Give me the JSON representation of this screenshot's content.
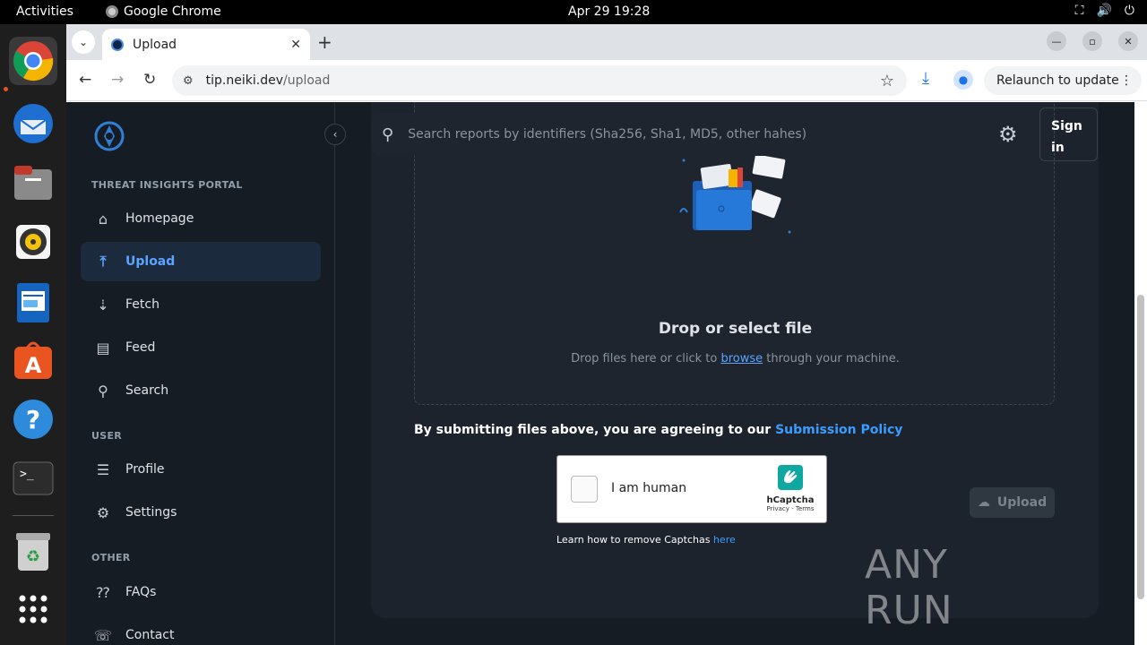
{
  "os": {
    "activities": "Activities",
    "app_name": "Google Chrome",
    "clock": "Apr 29  19:28"
  },
  "browser": {
    "tab_title": "Upload",
    "url_domain": "tip.neiki.dev",
    "url_path": "/upload",
    "relaunch_label": "Relaunch to update"
  },
  "sidebar": {
    "section_portal": "THREAT INSIGHTS PORTAL",
    "section_user": "USER",
    "section_other": "OTHER",
    "items": [
      {
        "label": "Homepage",
        "icon": "home-icon"
      },
      {
        "label": "Upload",
        "icon": "upload-icon"
      },
      {
        "label": "Fetch",
        "icon": "fetch-icon"
      },
      {
        "label": "Feed",
        "icon": "feed-icon"
      },
      {
        "label": "Search",
        "icon": "search-icon"
      },
      {
        "label": "Profile",
        "icon": "profile-icon"
      },
      {
        "label": "Settings",
        "icon": "gear-icon"
      },
      {
        "label": "FAQs",
        "icon": "faq-icon"
      },
      {
        "label": "Contact",
        "icon": "contact-icon"
      }
    ]
  },
  "header": {
    "search_placeholder": "Search reports by identifiers (Sha256, Sha1, MD5, other hahes)",
    "sign_in": "Sign in"
  },
  "upload": {
    "title": "Drop or select file",
    "sub_before": "Drop files here or click to ",
    "browse": "browse",
    "sub_after": " through your machine.",
    "agree_text": "By submitting files above, you are agreeing to our ",
    "policy_link": "Submission Policy",
    "captcha_label": "I am human",
    "captcha_brand": "hCaptcha",
    "captcha_links": "Privacy - Terms",
    "learn_text": "Learn how to remove Captchas ",
    "learn_link": "here",
    "upload_button": "Upload"
  },
  "watermark": "ANY RUN",
  "colors": {
    "accent": "#3b9cff",
    "page_bg": "#161c24",
    "card_bg": "#1c232c"
  }
}
